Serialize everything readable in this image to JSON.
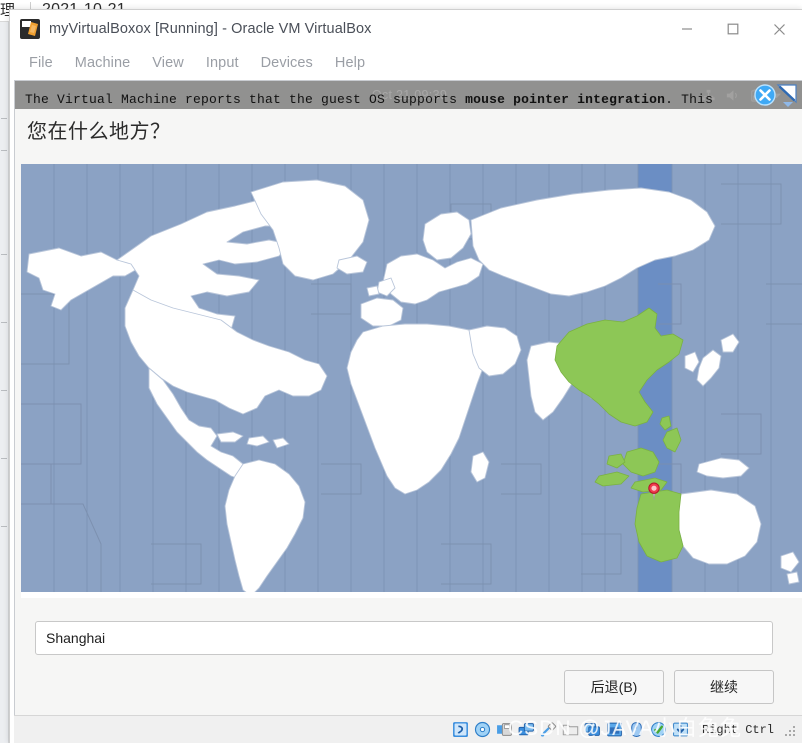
{
  "background": {
    "label": "理",
    "date": "2021-10-21"
  },
  "vbox": {
    "title": "myVirtualBoxox [Running] - Oracle VM VirtualBox",
    "app_icon_name": "virtualbox-icon",
    "menus": [
      {
        "label": "File",
        "name": "menu-file"
      },
      {
        "label": "Machine",
        "name": "menu-machine"
      },
      {
        "label": "View",
        "name": "menu-view"
      },
      {
        "label": "Input",
        "name": "menu-input"
      },
      {
        "label": "Devices",
        "name": "menu-devices"
      },
      {
        "label": "Help",
        "name": "menu-help"
      }
    ],
    "window_controls": {
      "minimize": "minimize-button",
      "maximize": "maximize-button",
      "close": "close-button"
    },
    "notification": {
      "text_before": "The Virtual Machine reports that the guest OS supports ",
      "text_bold": "mouse pointer integration",
      "text_after": ". This",
      "full_text": "The Virtual Machine reports that the guest OS supports mouse pointer integration. This",
      "close_icon": "close-circle-icon",
      "expand_icon": "expand-arrow-icon"
    },
    "statusbar": {
      "host_key": "Right Ctrl",
      "icons": [
        {
          "name": "status-hard-disk-icon"
        },
        {
          "name": "status-optical-disk-icon"
        },
        {
          "name": "status-floppy-disk-icon"
        },
        {
          "name": "status-network-icon"
        },
        {
          "name": "status-usb-icon"
        },
        {
          "name": "status-shared-folder-icon"
        },
        {
          "name": "status-display-icon"
        },
        {
          "name": "status-recording-icon"
        },
        {
          "name": "status-mouse-icon"
        },
        {
          "name": "status-keyboard-icon"
        },
        {
          "name": "status-update-icon"
        },
        {
          "name": "status-capture-icon"
        }
      ]
    }
  },
  "guest": {
    "panel": {
      "clock": "Oct 21 09:39",
      "tray_icons": [
        {
          "name": "network-icon"
        },
        {
          "name": "volume-icon"
        },
        {
          "name": "battery-icon"
        },
        {
          "name": "session-menu-icon"
        }
      ]
    },
    "installer": {
      "heading": "您在什么地方？",
      "location_value": "Shanghai",
      "location_placeholder": "",
      "buttons": {
        "back": "后退(B)",
        "continue": "继续"
      },
      "map": {
        "ocean_color": "#8ba2c4",
        "land_color": "#ffffff",
        "highlight_color": "#8dc756",
        "selected_zone_color": "#6b8ec4",
        "border_color": "#b9c6da",
        "pin_color": "#e8273a"
      }
    }
  },
  "watermark": {
    "text": "CSDN @JAVA小白兔兔"
  }
}
